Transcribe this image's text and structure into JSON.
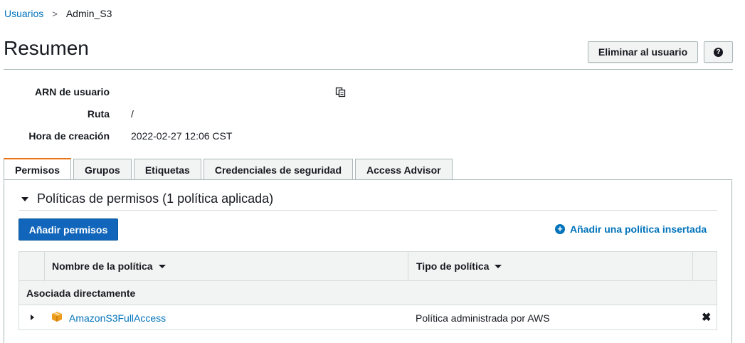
{
  "breadcrumb": {
    "parent": "Usuarios",
    "separator": ">",
    "current": "Admin_S3"
  },
  "page": {
    "title": "Resumen",
    "delete_label": "Eliminar al usuario",
    "help_label": "?"
  },
  "summary": {
    "arn_label": "ARN de usuario",
    "arn_value": "",
    "path_label": "Ruta",
    "path_value": "/",
    "created_label": "Hora de creación",
    "created_value": "2022-02-27 12:06 CST"
  },
  "tabs": [
    {
      "label": "Permisos",
      "active": true
    },
    {
      "label": "Grupos"
    },
    {
      "label": "Etiquetas"
    },
    {
      "label": "Credenciales de seguridad"
    },
    {
      "label": "Access Advisor"
    }
  ],
  "permissions": {
    "section_title": "Políticas de permisos (1 política aplicada)",
    "add_button": "Añadir permisos",
    "add_inline": "Añadir una política insertada",
    "columns": {
      "name": "Nombre de la política",
      "type": "Tipo de política"
    },
    "group_label": "Asociada directamente",
    "rows": [
      {
        "name": "AmazonS3FullAccess",
        "type": "Política administrada por AWS"
      }
    ]
  },
  "icons": {
    "copy": "copy-icon",
    "help": "help-icon",
    "plus": "plus-circle-icon",
    "policy": "policy-cube-icon",
    "remove": "close-icon"
  },
  "colors": {
    "link": "#0073bb",
    "primary": "#1166bb",
    "tab_accent": "#ec7211"
  }
}
